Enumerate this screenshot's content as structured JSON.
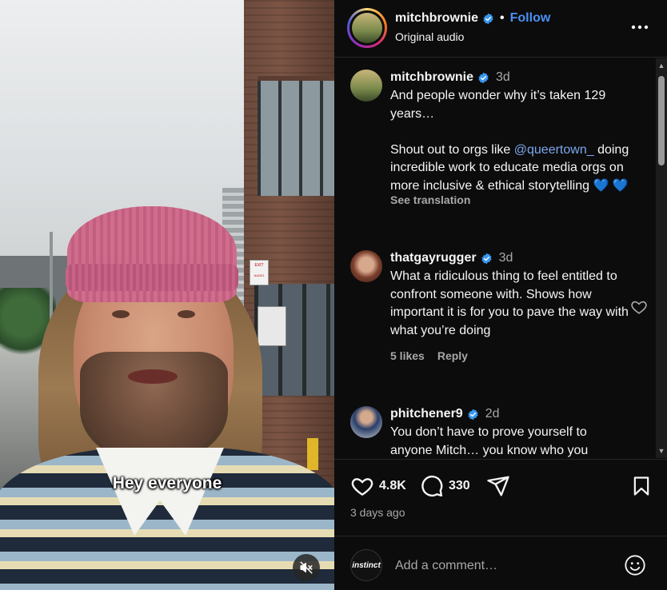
{
  "video": {
    "caption": "Hey everyone",
    "signs": [
      "EXIT",
      "AUDIO"
    ]
  },
  "header": {
    "username": "mitchbrownie",
    "separator": "•",
    "follow_label": "Follow",
    "audio_label": "Original audio"
  },
  "comments": [
    {
      "username": "mitchbrownie",
      "time": "3d",
      "verified": true,
      "text_before": "And people wonder why it’s taken 129 years…\n\nShout out to orgs like ",
      "mention": "@queertown_",
      "text_after": " doing incredible work to educate media orgs on more inclusive & ethical storytelling 💙 💙",
      "translate": "See translation"
    },
    {
      "username": "thatgayrugger",
      "time": "3d",
      "verified": true,
      "text": "What a ridiculous thing to feel entitled to confront someone with. Shows how important it is for you to pave the way with what you’re doing",
      "likes": "5 likes",
      "reply": "Reply"
    },
    {
      "username": "phitchener9",
      "time": "2d",
      "verified": true,
      "text": "You don’t have to prove yourself to anyone Mitch… you know who you"
    }
  ],
  "actions": {
    "likes_count": "4.8K",
    "comments_count": "330",
    "posted": "3 days ago"
  },
  "add_comment": {
    "avatar_text": "instinct",
    "placeholder": "Add a comment…"
  },
  "colors": {
    "accent": "#4a90f5",
    "mention": "#7da7f0",
    "verified": "#3897f0",
    "panel_bg": "#0c0c0c",
    "muted_text": "#a8a8a8"
  }
}
